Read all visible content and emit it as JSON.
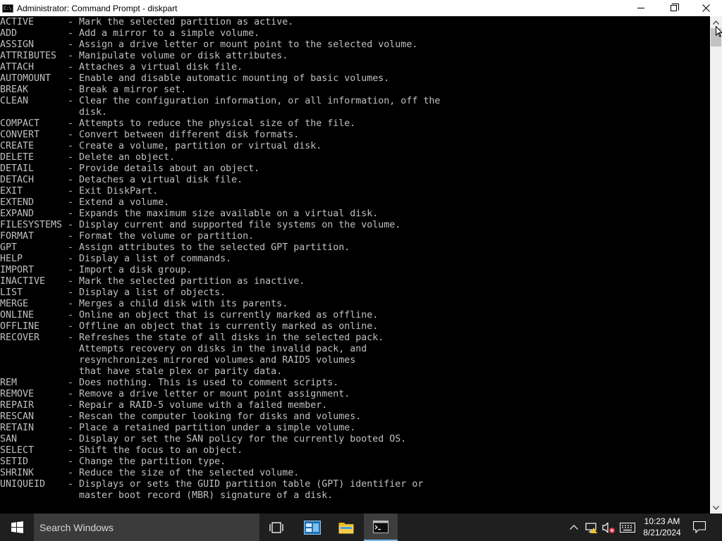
{
  "window": {
    "title": "Administrator: Command Prompt - diskpart",
    "icon_text": "C:\\"
  },
  "commands": [
    {
      "name": "ACTIVE",
      "desc": "Mark the selected partition as active."
    },
    {
      "name": "ADD",
      "desc": "Add a mirror to a simple volume."
    },
    {
      "name": "ASSIGN",
      "desc": "Assign a drive letter or mount point to the selected volume."
    },
    {
      "name": "ATTRIBUTES",
      "desc": "Manipulate volume or disk attributes."
    },
    {
      "name": "ATTACH",
      "desc": "Attaches a virtual disk file."
    },
    {
      "name": "AUTOMOUNT",
      "desc": "Enable and disable automatic mounting of basic volumes."
    },
    {
      "name": "BREAK",
      "desc": "Break a mirror set."
    },
    {
      "name": "CLEAN",
      "desc": "Clear the configuration information, or all information, off the"
    },
    {
      "name": "",
      "desc": "disk."
    },
    {
      "name": "COMPACT",
      "desc": "Attempts to reduce the physical size of the file."
    },
    {
      "name": "CONVERT",
      "desc": "Convert between different disk formats."
    },
    {
      "name": "CREATE",
      "desc": "Create a volume, partition or virtual disk."
    },
    {
      "name": "DELETE",
      "desc": "Delete an object."
    },
    {
      "name": "DETAIL",
      "desc": "Provide details about an object."
    },
    {
      "name": "DETACH",
      "desc": "Detaches a virtual disk file."
    },
    {
      "name": "EXIT",
      "desc": "Exit DiskPart."
    },
    {
      "name": "EXTEND",
      "desc": "Extend a volume."
    },
    {
      "name": "EXPAND",
      "desc": "Expands the maximum size available on a virtual disk."
    },
    {
      "name": "FILESYSTEMS",
      "desc": "Display current and supported file systems on the volume."
    },
    {
      "name": "FORMAT",
      "desc": "Format the volume or partition."
    },
    {
      "name": "GPT",
      "desc": "Assign attributes to the selected GPT partition."
    },
    {
      "name": "HELP",
      "desc": "Display a list of commands."
    },
    {
      "name": "IMPORT",
      "desc": "Import a disk group."
    },
    {
      "name": "INACTIVE",
      "desc": "Mark the selected partition as inactive."
    },
    {
      "name": "LIST",
      "desc": "Display a list of objects."
    },
    {
      "name": "MERGE",
      "desc": "Merges a child disk with its parents."
    },
    {
      "name": "ONLINE",
      "desc": "Online an object that is currently marked as offline."
    },
    {
      "name": "OFFLINE",
      "desc": "Offline an object that is currently marked as online."
    },
    {
      "name": "RECOVER",
      "desc": "Refreshes the state of all disks in the selected pack."
    },
    {
      "name": "",
      "desc": "Attempts recovery on disks in the invalid pack, and"
    },
    {
      "name": "",
      "desc": "resynchronizes mirrored volumes and RAID5 volumes"
    },
    {
      "name": "",
      "desc": "that have stale plex or parity data."
    },
    {
      "name": "REM",
      "desc": "Does nothing. This is used to comment scripts."
    },
    {
      "name": "REMOVE",
      "desc": "Remove a drive letter or mount point assignment."
    },
    {
      "name": "REPAIR",
      "desc": "Repair a RAID-5 volume with a failed member."
    },
    {
      "name": "RESCAN",
      "desc": "Rescan the computer looking for disks and volumes."
    },
    {
      "name": "RETAIN",
      "desc": "Place a retained partition under a simple volume."
    },
    {
      "name": "SAN",
      "desc": "Display or set the SAN policy for the currently booted OS."
    },
    {
      "name": "SELECT",
      "desc": "Shift the focus to an object."
    },
    {
      "name": "SETID",
      "desc": "Change the partition type."
    },
    {
      "name": "SHRINK",
      "desc": "Reduce the size of the selected volume."
    },
    {
      "name": "UNIQUEID",
      "desc": "Displays or sets the GUID partition table (GPT) identifier or"
    },
    {
      "name": "",
      "desc": "master boot record (MBR) signature of a disk."
    }
  ],
  "taskbar": {
    "search_placeholder": "Search Windows",
    "time": "10:23 AM",
    "date": "8/21/2024"
  },
  "colors": {
    "console_bg": "#000000",
    "console_text": "#c0c0c0",
    "taskbar_bg": "#1f1f1f",
    "accent": "#76b9ed"
  }
}
